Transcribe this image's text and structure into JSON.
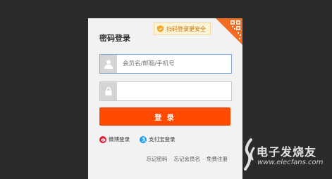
{
  "login_panel": {
    "title": "密码登录",
    "qr_tip": "扫码登录更安全",
    "username_placeholder": "会员名/邮箱/手机号",
    "password_value": "",
    "submit_label": "登 录",
    "weibo_label": "微博登录",
    "alipay_label": "支付宝登录",
    "links": [
      "忘记密码",
      "忘记会员名",
      "免费注册"
    ]
  },
  "watermark": {
    "text_cn": "电子发烧友",
    "url": "www.elecfans.com"
  },
  "colors": {
    "background": "#2b2b2b",
    "panel": "#f2f2f2",
    "accent": "#ff4a00",
    "qr_orange": "#f26d22",
    "focus_border": "#7aa7e0"
  },
  "icons": [
    "shield-icon",
    "qr-code-icon",
    "user-icon",
    "lock-icon",
    "weibo-icon",
    "alipay-icon",
    "elecfans-logo"
  ]
}
